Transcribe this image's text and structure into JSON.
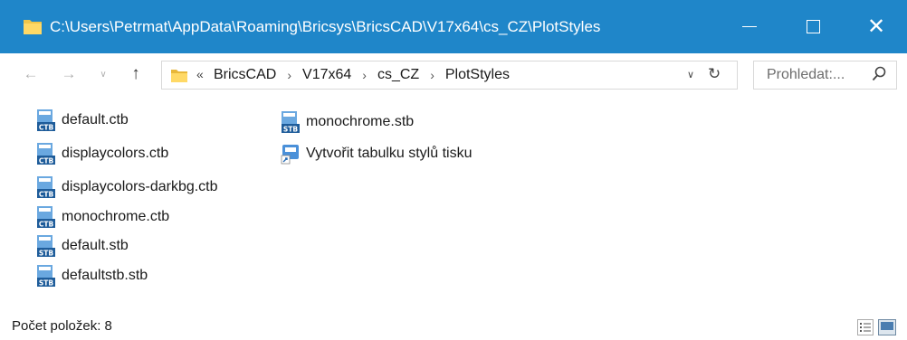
{
  "window": {
    "title": "C:\\Users\\Petrmat\\AppData\\Roaming\\Bricsys\\BricsCAD\\V17x64\\cs_CZ\\PlotStyles",
    "accent": "#1f86c9",
    "controls": {
      "minimize": "—",
      "maximize": "☐",
      "close": "✕"
    }
  },
  "nav": {
    "back": "←",
    "forward": "→",
    "recent": "∨",
    "up": "↑"
  },
  "address": {
    "overflow": "«",
    "crumbs": [
      "BricsCAD",
      "V17x64",
      "cs_CZ",
      "PlotStyles"
    ],
    "separator": "›",
    "dropdown": "∨",
    "refresh": "↻"
  },
  "search": {
    "placeholder": "Prohledat:...",
    "icon": "⚲"
  },
  "files": [
    {
      "name": "default.ctb",
      "icon": "ctb-file-icon",
      "badge": "CTB"
    },
    {
      "name": "displaycolors.ctb",
      "icon": "ctb-file-icon",
      "badge": "CTB"
    },
    {
      "name": "displaycolors-darkbg.ctb",
      "icon": "ctb-file-icon",
      "badge": "CTB"
    },
    {
      "name": "monochrome.ctb",
      "icon": "ctb-file-icon",
      "badge": "CTB"
    },
    {
      "name": "default.stb",
      "icon": "stb-file-icon",
      "badge": "STB"
    },
    {
      "name": "defaultstb.stb",
      "icon": "stb-file-icon",
      "badge": "STB"
    },
    {
      "name": "monochrome.stb",
      "icon": "stb-file-icon",
      "badge": "STB"
    },
    {
      "name": "Vytvořit tabulku stylů tisku",
      "icon": "shortcut-wizard-icon",
      "badge": ""
    }
  ],
  "status": {
    "item_count": "Počet položek: 8"
  }
}
